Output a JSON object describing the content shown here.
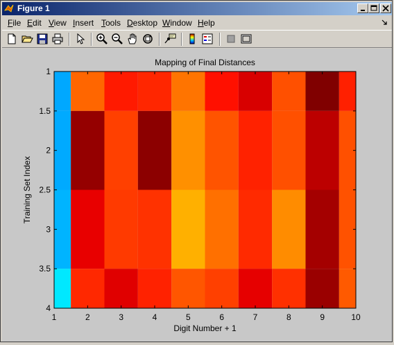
{
  "window": {
    "title": "Figure 1"
  },
  "menu": {
    "items": [
      {
        "label": "File",
        "accel": "F",
        "rest": "ile"
      },
      {
        "label": "Edit",
        "accel": "E",
        "rest": "dit"
      },
      {
        "label": "View",
        "accel": "V",
        "rest": "iew"
      },
      {
        "label": "Insert",
        "accel": "I",
        "rest": "nsert"
      },
      {
        "label": "Tools",
        "accel": "T",
        "rest": "ools"
      },
      {
        "label": "Desktop",
        "accel": "D",
        "rest": "esktop"
      },
      {
        "label": "Window",
        "accel": "W",
        "rest": "indow"
      },
      {
        "label": "Help",
        "accel": "H",
        "rest": "elp"
      }
    ]
  },
  "toolbar": {
    "icons": [
      "new-figure-icon",
      "open-file-icon",
      "save-icon",
      "print-icon",
      "select-arrow-icon",
      "zoom-in-icon",
      "zoom-out-icon",
      "pan-hand-icon",
      "rotate-3d-icon",
      "data-cursor-icon",
      "insert-colorbar-icon",
      "insert-legend-icon",
      "hide-plot-tools-icon",
      "show-plot-tools-icon"
    ]
  },
  "colors": {
    "titlebar_start": "#0a246a",
    "titlebar_end": "#a6caf0",
    "figure_background": "#c8c8c8"
  },
  "chart_data": {
    "type": "heatmap",
    "title": "Mapping of Final Distances",
    "xlabel": "Digit Number + 1",
    "ylabel": "Training Set Index",
    "xlim": [
      1,
      10
    ],
    "ylim": [
      1,
      4
    ],
    "y_reversed": true,
    "x_ticks": [
      1,
      2,
      3,
      4,
      5,
      6,
      7,
      8,
      9,
      10
    ],
    "y_ticks": [
      1,
      1.5,
      2,
      2.5,
      3,
      3.5,
      4
    ],
    "colormap": "jet",
    "x_centers": [
      1,
      2,
      3,
      4,
      5,
      6,
      7,
      8,
      9,
      10
    ],
    "y_centers": [
      1,
      2,
      3,
      4
    ],
    "cells": [
      [
        "#00a8ff",
        "#ff6600",
        "#ff1a00",
        "#ff2600",
        "#ff7400",
        "#ff1000",
        "#d80000",
        "#ff5000",
        "#800000",
        "#ff2000"
      ],
      [
        "#00aaff",
        "#950000",
        "#ff4000",
        "#8c0000",
        "#ff9000",
        "#ff5400",
        "#ff2200",
        "#ff5000",
        "#bc0000",
        "#ff5000"
      ],
      [
        "#00b4ff",
        "#e80000",
        "#ff3a00",
        "#ff3200",
        "#ffb000",
        "#ff7000",
        "#ff2a00",
        "#ff8c00",
        "#a40000",
        "#ff5200"
      ],
      [
        "#00e8ff",
        "#ff2800",
        "#e00000",
        "#ff2200",
        "#ff5600",
        "#ff4000",
        "#e60000",
        "#ff3000",
        "#9a0000",
        "#ff5a00"
      ]
    ],
    "grid": false,
    "legend": "none"
  }
}
